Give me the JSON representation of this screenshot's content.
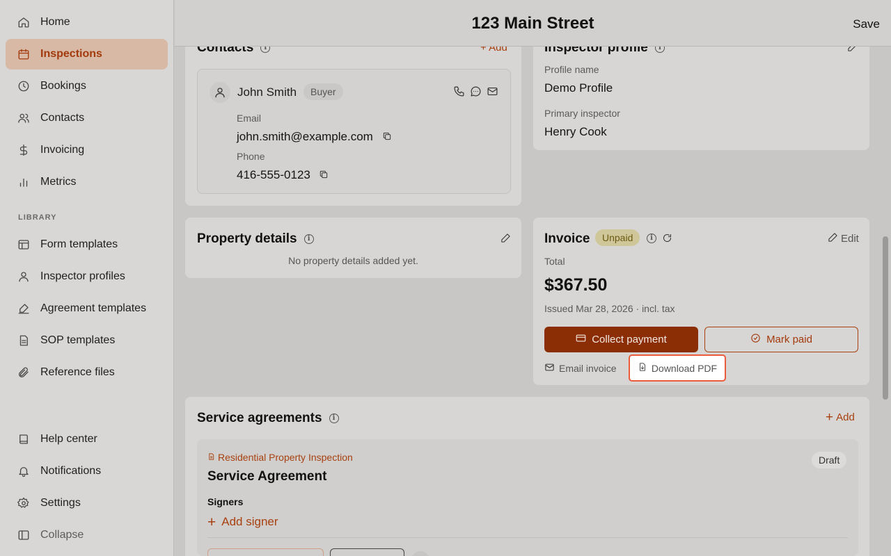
{
  "sidebar": {
    "items": [
      {
        "label": "Home",
        "icon": "home-icon"
      },
      {
        "label": "Inspections",
        "icon": "calendar-icon"
      },
      {
        "label": "Bookings",
        "icon": "clock-icon"
      },
      {
        "label": "Contacts",
        "icon": "users-icon"
      },
      {
        "label": "Invoicing",
        "icon": "dollar-icon"
      },
      {
        "label": "Metrics",
        "icon": "bar-chart-icon"
      }
    ],
    "library_label": "LIBRARY",
    "library_items": [
      {
        "label": "Form templates",
        "icon": "layout-icon"
      },
      {
        "label": "Inspector profiles",
        "icon": "user-icon"
      },
      {
        "label": "Agreement templates",
        "icon": "signature-icon"
      },
      {
        "label": "SOP templates",
        "icon": "file-text-icon"
      },
      {
        "label": "Reference files",
        "icon": "paperclip-icon"
      }
    ],
    "bottom_items": [
      {
        "label": "Help center",
        "icon": "book-icon"
      },
      {
        "label": "Notifications",
        "icon": "bell-icon"
      },
      {
        "label": "Settings",
        "icon": "gear-icon"
      },
      {
        "label": "Collapse",
        "icon": "sidebar-collapse-icon"
      }
    ]
  },
  "header": {
    "title": "123 Main Street",
    "save_label": "Save"
  },
  "contacts": {
    "title": "Contacts",
    "add_label": "+ Add",
    "contact": {
      "name": "John Smith",
      "role": "Buyer",
      "email_label": "Email",
      "email": "john.smith@example.com",
      "phone_label": "Phone",
      "phone": "416-555-0123"
    }
  },
  "inspector_profile": {
    "title": "Inspector profile",
    "profile_name_label": "Profile name",
    "profile_name": "Demo Profile",
    "primary_inspector_label": "Primary inspector",
    "primary_inspector": "Henry Cook"
  },
  "property_details": {
    "title": "Property details",
    "empty_text": "No property details added yet."
  },
  "invoice": {
    "title": "Invoice",
    "status": "Unpaid",
    "edit_label": "Edit",
    "total_label": "Total",
    "total": "$367.50",
    "issued": "Issued Mar 28, 2026 · incl. tax",
    "collect_label": "Collect payment",
    "mark_paid_label": "Mark paid",
    "email_invoice_label": "Email invoice",
    "download_pdf_label": "Download PDF"
  },
  "service_agreements": {
    "title": "Service agreements",
    "add_label": "Add",
    "agreement": {
      "template": "Residential Property Inspection",
      "title": "Service Agreement",
      "status": "Draft",
      "signers_label": "Signers",
      "add_signer_label": "Add signer"
    }
  },
  "colors": {
    "accent": "#a8400f",
    "primary_button": "#8c2e05",
    "highlight": "#ec5b3c"
  }
}
